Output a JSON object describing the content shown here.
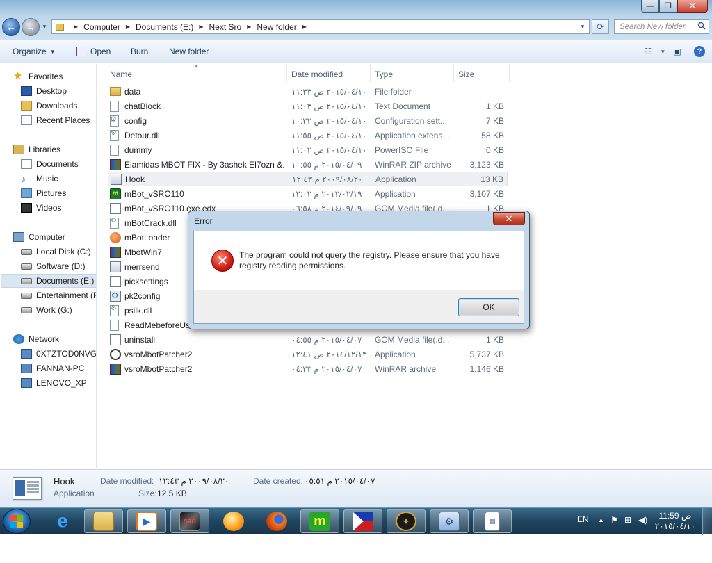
{
  "window": {
    "controls": {
      "minimize": "—",
      "maximize": "❐",
      "close": "✕"
    }
  },
  "address_bar": {
    "crumbs": [
      "Computer",
      "Documents (E:)",
      "Next Sro",
      "New folder"
    ],
    "search_placeholder": "Search New folder"
  },
  "command_bar": {
    "organize": "Organize",
    "open": "Open",
    "burn": "Burn",
    "new_folder": "New folder"
  },
  "nav_pane": {
    "favorites": {
      "label": "Favorites",
      "items": [
        "Desktop",
        "Downloads",
        "Recent Places"
      ]
    },
    "libraries": {
      "label": "Libraries",
      "items": [
        "Documents",
        "Music",
        "Pictures",
        "Videos"
      ]
    },
    "computer": {
      "label": "Computer",
      "items": [
        "Local Disk (C:)",
        "Software (D:)",
        "Documents (E:)",
        "Entertainment (F",
        "Work (G:)"
      ]
    },
    "network": {
      "label": "Network",
      "items": [
        "0XTZTOD0NVGP",
        "FANNAN-PC",
        "LENOVO_XP"
      ]
    }
  },
  "columns": {
    "name": "Name",
    "date": "Date modified",
    "type": "Type",
    "size": "Size"
  },
  "files": [
    {
      "name": "data",
      "date": "٢٠١٥/٠٤/١٠ ص ١١:٣٣",
      "type": "File folder",
      "size": "",
      "icon": "folder-icon"
    },
    {
      "name": "chatBlock",
      "date": "٢٠١٥/٠٤/١٠ ص ١١:٠٣",
      "type": "Text Document",
      "size": "1 KB",
      "icon": "text-document-icon"
    },
    {
      "name": "config",
      "date": "٢٠١٥/٠٤/١٠ ص ١٠:٣٢",
      "type": "Configuration sett...",
      "size": "7 KB",
      "icon": "config-file-icon"
    },
    {
      "name": "Detour.dll",
      "date": "٢٠١٥/٠٤/١٠ ص ١١:٥٥",
      "type": "Application extens...",
      "size": "58 KB",
      "icon": "dll-file-icon"
    },
    {
      "name": "dummy",
      "date": "٢٠١٥/٠٤/١٠ ص ١١:٠٢",
      "type": "PowerISO File",
      "size": "0 KB",
      "icon": "blank-file-icon"
    },
    {
      "name": "Elamidas MBOT FIX - By 3ashek El7ozn &...",
      "date": "٢٠١٥/٠٤/٠٩ م ١٠:٥٥",
      "type": "WinRAR ZIP archive",
      "size": "3,123 KB",
      "icon": "winrar-icon"
    },
    {
      "name": "Hook",
      "date": "٢٠٠٩/٠٨/٢٠ م ١٢:٤٣",
      "type": "Application",
      "size": "13 KB",
      "icon": "application-icon"
    },
    {
      "name": "mBot_vSRO110",
      "date": "٢٠١٢/٠٢/١٩ م ١٢:٠٢",
      "type": "Application",
      "size": "3,107 KB",
      "icon": "mbot-icon"
    },
    {
      "name": "mBot_vSRO110.exe.edx",
      "date": "٢٠١٤/٠٩/٠٩ م ٠٦:٥٨",
      "type": "GOM Media file(.d...",
      "size": "1 KB",
      "icon": "gom-file-icon"
    },
    {
      "name": "mBotCrack.dll",
      "date": "",
      "type": "",
      "size": "",
      "icon": "dll-file-icon"
    },
    {
      "name": "mBotLoader",
      "date": "",
      "type": "",
      "size": "",
      "icon": "loader-icon"
    },
    {
      "name": "MbotWin7",
      "date": "",
      "type": "",
      "size": "",
      "icon": "winrar-icon"
    },
    {
      "name": "merrsend",
      "date": "",
      "type": "",
      "size": "",
      "icon": "application-icon"
    },
    {
      "name": "picksettings",
      "date": "",
      "type": "",
      "size": "",
      "icon": "gom-file-icon"
    },
    {
      "name": "pk2config",
      "date": "",
      "type": "",
      "size": "",
      "icon": "settings-app-icon"
    },
    {
      "name": "psilk.dll",
      "date": "",
      "type": "",
      "size": "",
      "icon": "dll-file-icon"
    },
    {
      "name": "ReadMebeforeUs",
      "date": "",
      "type": "",
      "size": "",
      "icon": "text-document-icon"
    },
    {
      "name": "uninstall",
      "date": "٢٠١٥/٠٤/٠٧ م ٠٤:٥٥",
      "type": "GOM Media file(.d...",
      "size": "1 KB",
      "icon": "gom-file-icon"
    },
    {
      "name": "vsroMbotPatcher2",
      "date": "٢٠١٤/١٢/١٣ ص ١٢:٤١",
      "type": "Application",
      "size": "5,737 KB",
      "icon": "patcher-app-icon"
    },
    {
      "name": "vsroMbotPatcher2",
      "date": "٢٠١٥/٠٤/٠٧ م ٠٤:٣٣",
      "type": "WinRAR archive",
      "size": "1,146 KB",
      "icon": "winrar-icon"
    }
  ],
  "details_pane": {
    "name": "Hook",
    "type": "Application",
    "date_modified_label": "Date modified:",
    "date_modified": "٢٠٠٩/٠٨/٢٠ م ١٢:٤٣",
    "date_created_label": "Date created:",
    "date_created": "٢٠١٥/٠٤/٠٧ م ٠٥:٥١",
    "size_label": "Size:",
    "size": "12.5 KB"
  },
  "dialog": {
    "title": "Error",
    "close": "✕",
    "message": "The program could not query the registry. Please ensure that you have registry reading permissions.",
    "ok": "OK"
  },
  "taskbar": {
    "apps": [
      "internet-explorer",
      "windows-explorer",
      "media-player",
      "game-sro",
      "orange-app",
      "firefox",
      "mbot",
      "flag-app",
      "compass-app",
      "control-panel",
      "notepad-doc"
    ],
    "lang": "EN",
    "time": "11:59 ص",
    "date": "٢٠١٥/٠٤/١٠"
  },
  "colors": {
    "accent": "#2f66b3",
    "error_red": "#d01c12",
    "selection": "#eef0f3"
  }
}
